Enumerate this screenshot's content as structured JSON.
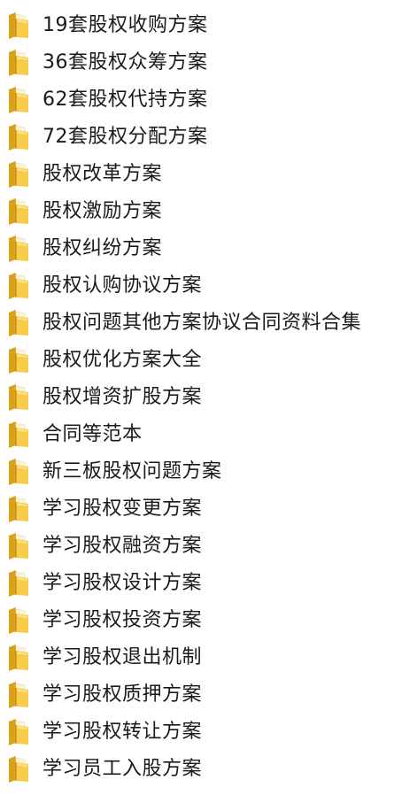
{
  "folders": [
    {
      "name": "19套股权收购方案",
      "icon": "folder-icon"
    },
    {
      "name": "36套股权众筹方案",
      "icon": "folder-icon"
    },
    {
      "name": "62套股权代持方案",
      "icon": "folder-icon"
    },
    {
      "name": "72套股权分配方案",
      "icon": "folder-icon"
    },
    {
      "name": "股权改革方案",
      "icon": "folder-icon"
    },
    {
      "name": "股权激励方案",
      "icon": "folder-icon"
    },
    {
      "name": "股权纠纷方案",
      "icon": "folder-icon"
    },
    {
      "name": "股权认购协议方案",
      "icon": "folder-icon"
    },
    {
      "name": "股权问题其他方案协议合同资料合集",
      "icon": "folder-icon"
    },
    {
      "name": "股权优化方案大全",
      "icon": "folder-icon"
    },
    {
      "name": "股权增资扩股方案",
      "icon": "folder-icon"
    },
    {
      "name": "合同等范本",
      "icon": "folder-icon"
    },
    {
      "name": "新三板股权问题方案",
      "icon": "folder-icon"
    },
    {
      "name": "学习股权变更方案",
      "icon": "folder-icon"
    },
    {
      "name": "学习股权融资方案",
      "icon": "folder-icon"
    },
    {
      "name": "学习股权设计方案",
      "icon": "folder-icon"
    },
    {
      "name": "学习股权投资方案",
      "icon": "folder-icon"
    },
    {
      "name": "学习股权退出机制",
      "icon": "folder-icon"
    },
    {
      "name": "学习股权质押方案",
      "icon": "folder-icon"
    },
    {
      "name": "学习股权转让方案",
      "icon": "folder-icon"
    },
    {
      "name": "学习员工入股方案",
      "icon": "folder-icon"
    }
  ],
  "colors": {
    "folder_back": "#d9a21a",
    "folder_front": "#f6cc4a",
    "folder_paper": "#fbf3d8",
    "text": "#1a1a1a"
  }
}
